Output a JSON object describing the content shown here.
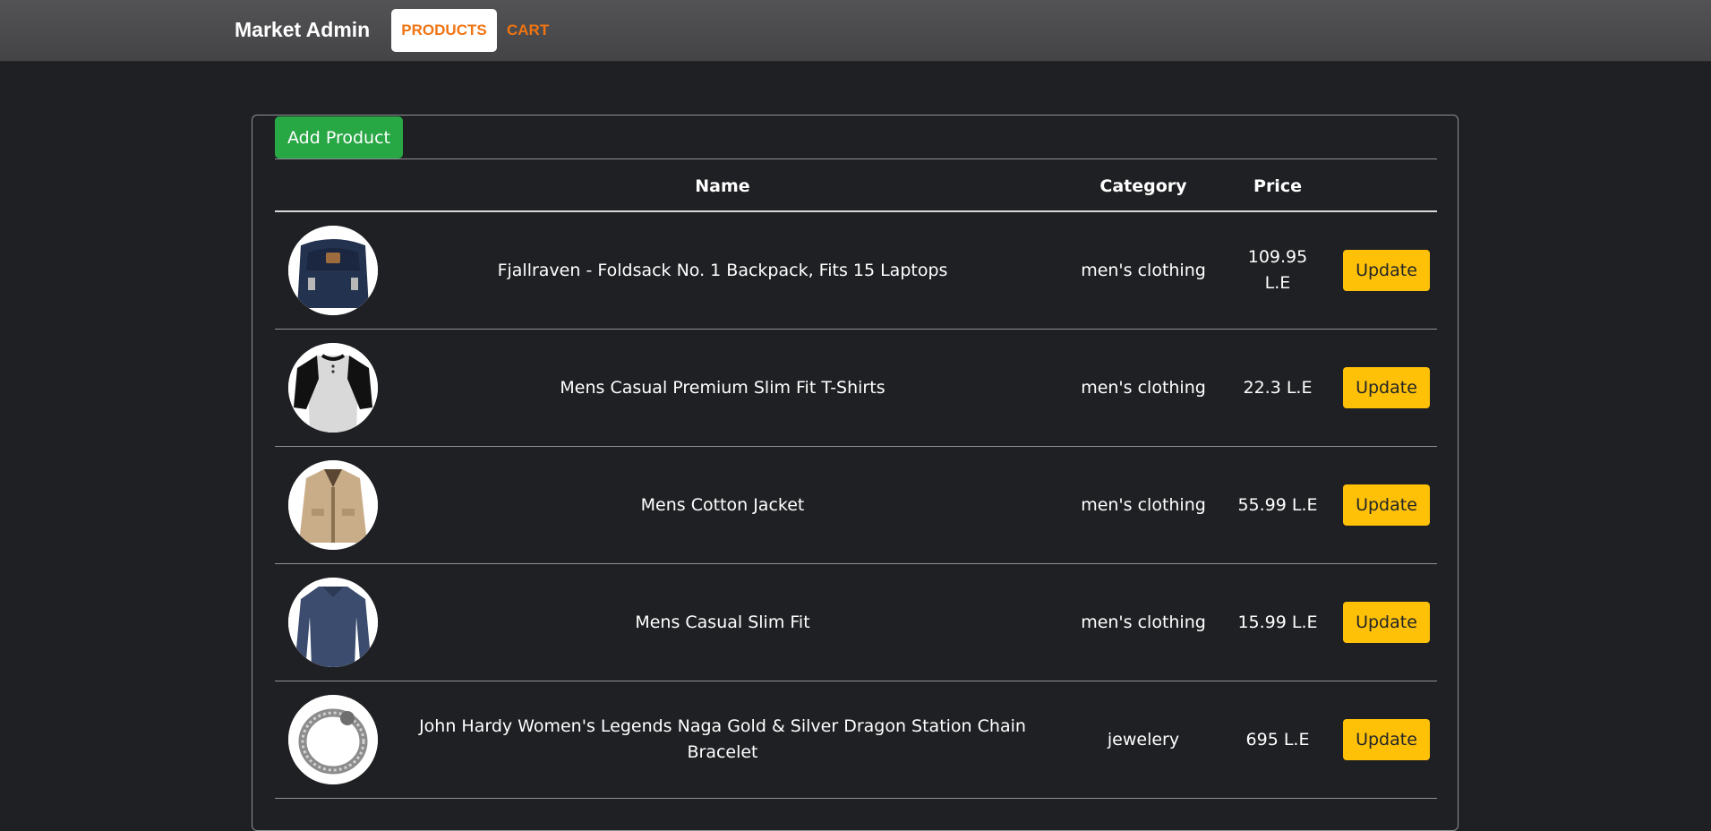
{
  "navbar": {
    "brand": "Market Admin",
    "links": [
      {
        "label": "PRODUCTS",
        "active": true
      },
      {
        "label": "CART",
        "active": false
      }
    ],
    "accent_color": "#f07412"
  },
  "products": {
    "add_button_label": "Add Product",
    "columns": [
      "Name",
      "Category",
      "Price"
    ],
    "update_label": "Update",
    "rows": [
      {
        "image_icon": "backpack-image",
        "name": "Fjallraven - Foldsack No. 1 Backpack, Fits 15 Laptops",
        "category": "men's clothing",
        "price": "109.95 L.E"
      },
      {
        "image_icon": "tshirt-image",
        "name": "Mens Casual Premium Slim Fit T-Shirts",
        "category": "men's clothing",
        "price": "22.3 L.E"
      },
      {
        "image_icon": "jacket-image",
        "name": "Mens Cotton Jacket",
        "category": "men's clothing",
        "price": "55.99 L.E"
      },
      {
        "image_icon": "longsleeve-image",
        "name": "Mens Casual Slim Fit",
        "category": "men's clothing",
        "price": "15.99 L.E"
      },
      {
        "image_icon": "bracelet-image",
        "name": "John Hardy Women's Legends Naga Gold & Silver Dragon Station Chain Bracelet",
        "category": "jewelery",
        "price": "695 L.E"
      }
    ]
  }
}
